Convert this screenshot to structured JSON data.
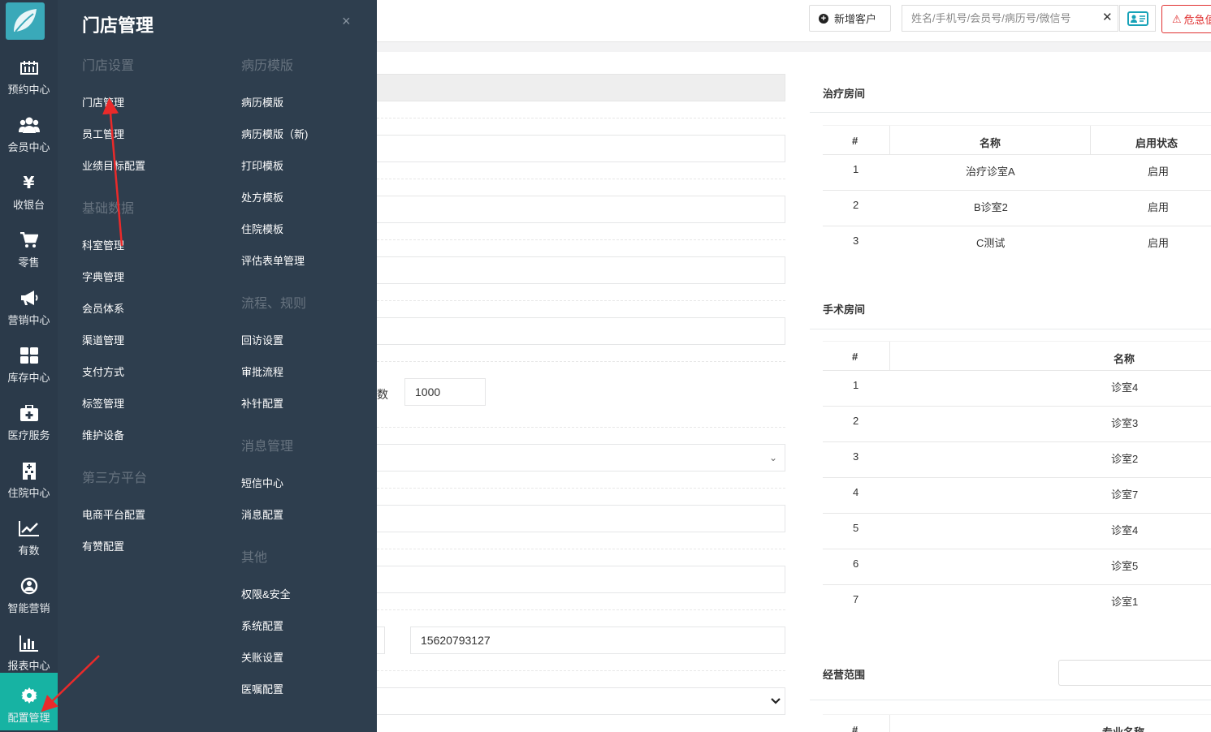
{
  "rail": {
    "items": [
      {
        "label": "预约中心",
        "icon": "calendar-grid-icon"
      },
      {
        "label": "会员中心",
        "icon": "users-icon"
      },
      {
        "label": "收银台",
        "icon": "yen-icon"
      },
      {
        "label": "零售",
        "icon": "cart-icon"
      },
      {
        "label": "营销中心",
        "icon": "megaphone-icon"
      },
      {
        "label": "库存中心",
        "icon": "grid-icon"
      },
      {
        "label": "医疗服务",
        "icon": "medkit-icon"
      },
      {
        "label": "住院中心",
        "icon": "hospital-icon"
      },
      {
        "label": "有数",
        "icon": "line-chart-icon"
      },
      {
        "label": "智能营销",
        "icon": "support-icon"
      },
      {
        "label": "报表中心",
        "icon": "bar-chart-icon"
      },
      {
        "label": "配置管理",
        "icon": "gear-icon"
      }
    ],
    "active_color": "#17b3a3"
  },
  "flyout": {
    "title": "门店管理",
    "close_icon": "×",
    "col_a": {
      "groups": [
        {
          "title": "门店设置",
          "items": [
            "门店管理",
            "员工管理",
            "业绩目标配置"
          ]
        },
        {
          "title": "基础数据",
          "items": [
            "科室管理",
            "字典管理",
            "会员体系",
            "渠道管理",
            "支付方式",
            "标签管理",
            "维护设备"
          ]
        },
        {
          "title": "第三方平台",
          "items": [
            "电商平台配置",
            "有赞配置"
          ]
        }
      ]
    },
    "col_b": {
      "groups": [
        {
          "title": "病历模版",
          "items": [
            "病历模版",
            "病历模版（新)",
            "打印模板",
            "处方模板",
            "住院模板",
            "评估表单管理"
          ]
        },
        {
          "title": "流程、规则",
          "items": [
            "回访设置",
            "审批流程",
            "补针配置"
          ]
        },
        {
          "title": "消息管理",
          "items": [
            "短信中心",
            "消息配置"
          ]
        },
        {
          "title": "其他",
          "items": [
            "权限&安全",
            "系统配置",
            "关账设置",
            "医嘱配置"
          ]
        }
      ]
    }
  },
  "topbar": {
    "new_customer": "新增客户",
    "search_placeholder": "姓名/手机号/会员号/病历号/微信号",
    "clear_icon": "✕",
    "danger_label": "危急值"
  },
  "form": {
    "number_label_tail": "数",
    "number_value": "1000",
    "phone_value": "15620793127",
    "chevron": "⌄"
  },
  "treatment_rooms": {
    "title": "治疗房间",
    "headers": [
      "#",
      "名称",
      "启用状态"
    ],
    "rows": [
      [
        "1",
        "治疗诊室A",
        "启用"
      ],
      [
        "2",
        "B诊室2",
        "启用"
      ],
      [
        "3",
        "C测试",
        "启用"
      ]
    ]
  },
  "surgery_rooms": {
    "title": "手术房间",
    "headers": [
      "#",
      "名称"
    ],
    "rows": [
      [
        "1",
        "诊室4"
      ],
      [
        "2",
        "诊室3"
      ],
      [
        "3",
        "诊室2"
      ],
      [
        "4",
        "诊室7"
      ],
      [
        "5",
        "诊室4"
      ],
      [
        "6",
        "诊室5"
      ],
      [
        "7",
        "诊室1"
      ]
    ]
  },
  "scope": {
    "title": "经营范围",
    "headers": [
      "#",
      "专业名称"
    ]
  }
}
